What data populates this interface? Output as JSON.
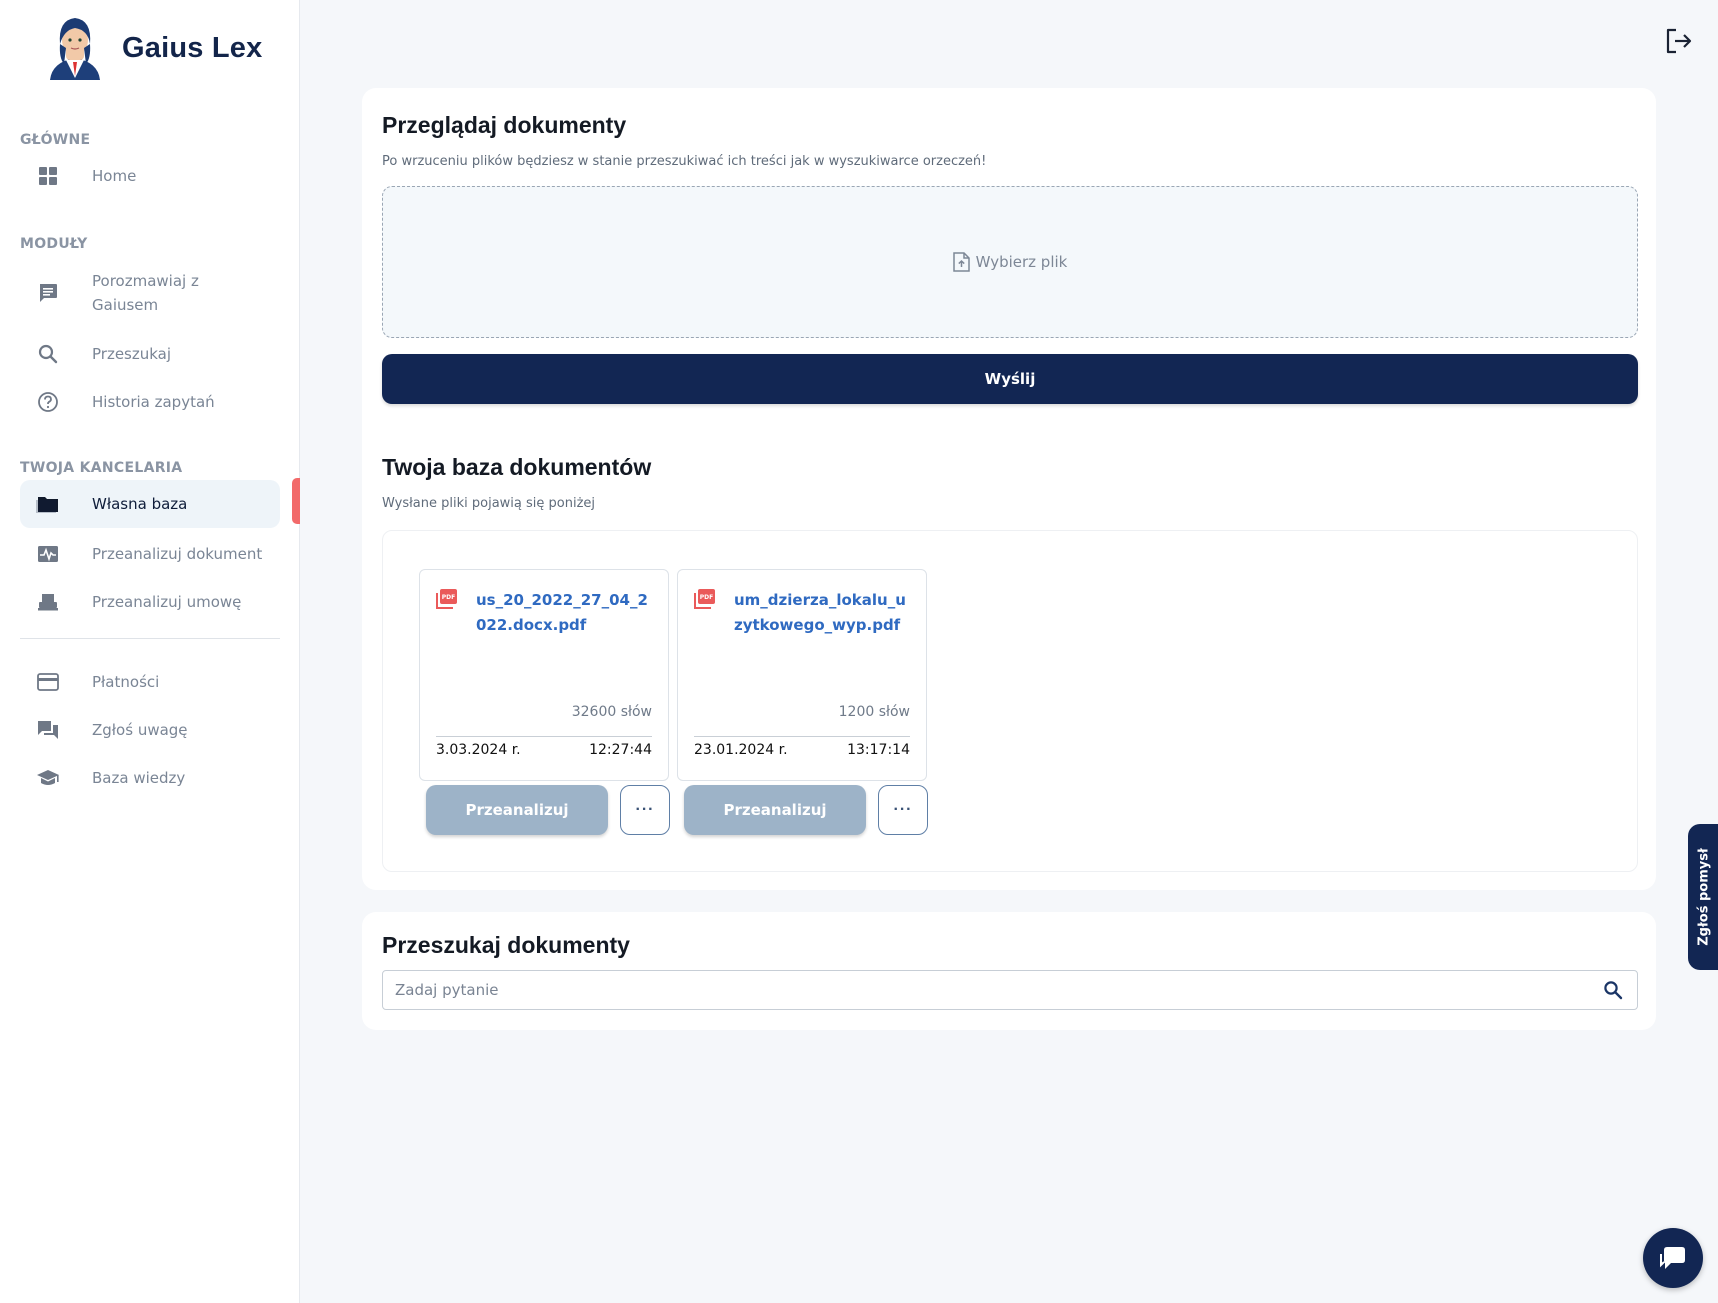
{
  "brand": {
    "name": "Gaius Lex"
  },
  "sidebar": {
    "sections": {
      "main": "GŁÓWNE",
      "modules": "MODUŁY",
      "office": "TWOJA KANCELARIA"
    },
    "items": {
      "home": "Home",
      "chat": "Porozmawiaj z Gaiusem",
      "search": "Przeszukaj",
      "history": "Historia zapytań",
      "own_base": "Własna baza",
      "analyze_doc": "Przeanalizuj dokument",
      "analyze_contract": "Przeanalizuj umowę",
      "payments": "Płatności",
      "report": "Zgłoś uwagę",
      "knowledge": "Baza wiedzy"
    },
    "active_item": "own_base"
  },
  "upload": {
    "title": "Przeglądaj dokumenty",
    "subtitle": "Po wrzuceniu plików będziesz w stanie przeszukiwać ich treści jak w wyszukiwarce orzeczeń!",
    "choose_file": "Wybierz plik",
    "send_label": "Wyślij"
  },
  "database": {
    "title": "Twoja baza dokumentów",
    "subtitle": "Wysłane pliki pojawią się poniżej",
    "documents": [
      {
        "filename": "us_20_2022_27_04_2022.docx.pdf",
        "words": "32600 słów",
        "date": "3.03.2024 r.",
        "time": "12:27:44",
        "analyze_label": "Przeanalizuj",
        "more_label": "···"
      },
      {
        "filename": "um_dzierza_lokalu_uzytkowego_wyp.pdf",
        "words": "1200 słów",
        "date": "23.01.2024 r.",
        "time": "13:17:14",
        "analyze_label": "Przeanalizuj",
        "more_label": "···"
      }
    ]
  },
  "search": {
    "title": "Przeszukaj dokumenty",
    "placeholder": "Zadaj pytanie",
    "value": ""
  },
  "feedback_tab": {
    "label": "Zgłoś pomysł"
  },
  "colors": {
    "navy": "#122653",
    "accent_red": "#f26a6a",
    "link_blue": "#2f6ac1",
    "disabled_button": "#9db3c8"
  },
  "icons": {
    "home": "grid-icon",
    "chat": "message-icon",
    "search": "search-icon",
    "history": "help-circle-icon",
    "own_base": "folder-icon",
    "analyze_doc": "pulse-icon",
    "analyze_contract": "printer-icon",
    "payments": "credit-card-icon",
    "report": "forum-icon",
    "knowledge": "graduation-cap-icon",
    "logout": "logout-icon",
    "pdf": "pdf-icon",
    "upload": "file-upload-icon",
    "chat_bubble": "chat-bubble-icon"
  }
}
